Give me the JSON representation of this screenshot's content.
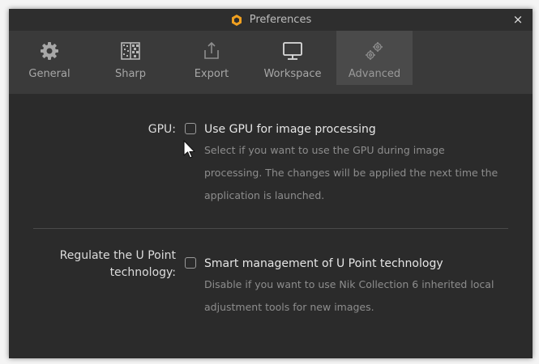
{
  "window": {
    "title": "Preferences",
    "close_glyph": "×"
  },
  "tabs": [
    {
      "label": "General",
      "icon": "gear-icon",
      "active": false
    },
    {
      "label": "Sharp",
      "icon": "sharpen-icon",
      "active": false
    },
    {
      "label": "Export",
      "icon": "export-icon",
      "active": false
    },
    {
      "label": "Workspace",
      "icon": "monitor-icon",
      "active": false
    },
    {
      "label": "Advanced",
      "icon": "gears-icon",
      "active": true
    }
  ],
  "settings": {
    "gpu": {
      "label": "GPU:",
      "option": "Use GPU for image processing",
      "checked": false,
      "description": "Select if you want to use the GPU during image processing. The changes will be applied the next time the application is launched."
    },
    "upoint": {
      "label": "Regulate the U Point technology:",
      "option": "Smart management of U Point technology",
      "checked": false,
      "description": "Disable if you want to use Nik Collection 6 inherited local adjustment tools for new images."
    }
  },
  "colors": {
    "background": "#2b2b2b",
    "tabbar": "#3a3a3a",
    "tab_active": "#4a4a4a",
    "logo_orange": "#f0a020"
  }
}
